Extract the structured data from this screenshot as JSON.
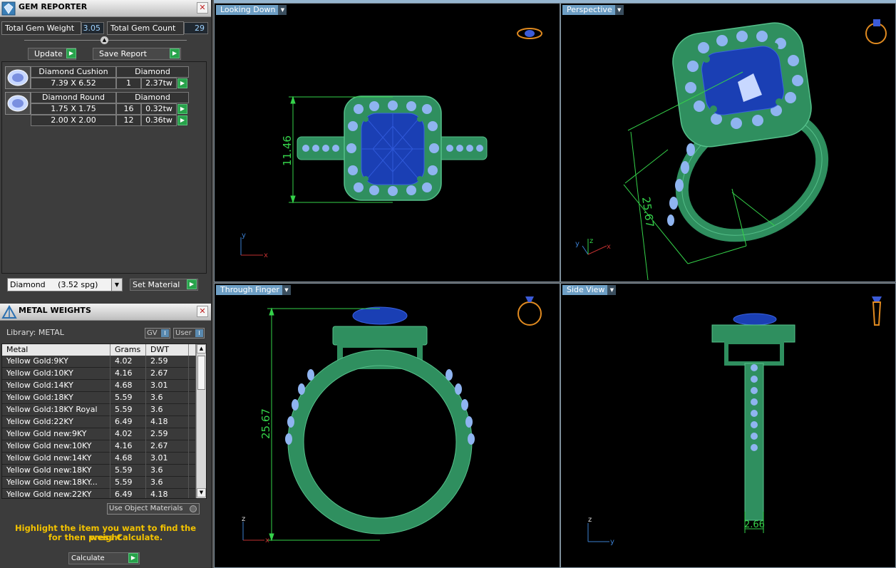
{
  "gem_reporter": {
    "title": "GEM REPORTER",
    "total_weight_label": "Total Gem Weight",
    "total_weight_value": "3.05",
    "total_count_label": "Total Gem Count",
    "total_count_value": "29",
    "update_label": "Update",
    "save_label": "Save Report",
    "gems": [
      {
        "name": "Diamond Cushion",
        "material": "Diamond",
        "rows": [
          {
            "size": "7.39 X 6.52",
            "count": "1",
            "weight": "2.37tw"
          }
        ]
      },
      {
        "name": "Diamond Round",
        "material": "Diamond",
        "rows": [
          {
            "size": "1.75 X 1.75",
            "count": "16",
            "weight": "0.32tw"
          },
          {
            "size": "2.00 X 2.00",
            "count": "12",
            "weight": "0.36tw"
          }
        ]
      }
    ],
    "material_select": "Diamond     (3.52 spg)",
    "set_material_label": "Set Material"
  },
  "metal_weights": {
    "title": "METAL WEIGHTS",
    "library_label": "Library: METAL",
    "gv_label": "GV",
    "user_label": "User",
    "columns": [
      "Metal",
      "Grams",
      "DWT"
    ],
    "rows": [
      [
        "Yellow Gold:9KY",
        "4.02",
        "2.59"
      ],
      [
        "Yellow Gold:10KY",
        "4.16",
        "2.67"
      ],
      [
        "Yellow Gold:14KY",
        "4.68",
        "3.01"
      ],
      [
        "Yellow Gold:18KY",
        "5.59",
        "3.6"
      ],
      [
        "Yellow Gold:18KY Royal",
        "5.59",
        "3.6"
      ],
      [
        "Yellow Gold:22KY",
        "6.49",
        "4.18"
      ],
      [
        "Yellow Gold new:9KY",
        "4.02",
        "2.59"
      ],
      [
        "Yellow Gold new:10KY",
        "4.16",
        "2.67"
      ],
      [
        "Yellow Gold new:14KY",
        "4.68",
        "3.01"
      ],
      [
        "Yellow Gold new:18KY",
        "5.59",
        "3.6"
      ],
      [
        "Yellow Gold new:18KY...",
        "5.59",
        "3.6"
      ],
      [
        "Yellow Gold new:22KY",
        "6.49",
        "4.18"
      ]
    ],
    "use_object_materials": "Use Object Materials",
    "hint_line1": "Highlight the item you want to find the weight",
    "hint_line2": "for then press Calculate.",
    "calculate_label": "Calculate"
  },
  "viewports": {
    "top_left": {
      "label": "Looking Down",
      "dimension": "11.46"
    },
    "top_right": {
      "label": "Perspective",
      "dimension": "25.67"
    },
    "bottom_left": {
      "label": "Through Finger",
      "dimension": "25.67"
    },
    "bottom_right": {
      "label": "Side View",
      "dimension": "2.66"
    }
  },
  "colors": {
    "metal": "#2f8f5f",
    "metal_edge": "#55c08a",
    "gem_blue": "#1a3fb4",
    "small_gem": "#8fb4f0",
    "dimension": "#35d24a",
    "accent_tab": "#6d9ec4",
    "hint": "#f2c200"
  }
}
